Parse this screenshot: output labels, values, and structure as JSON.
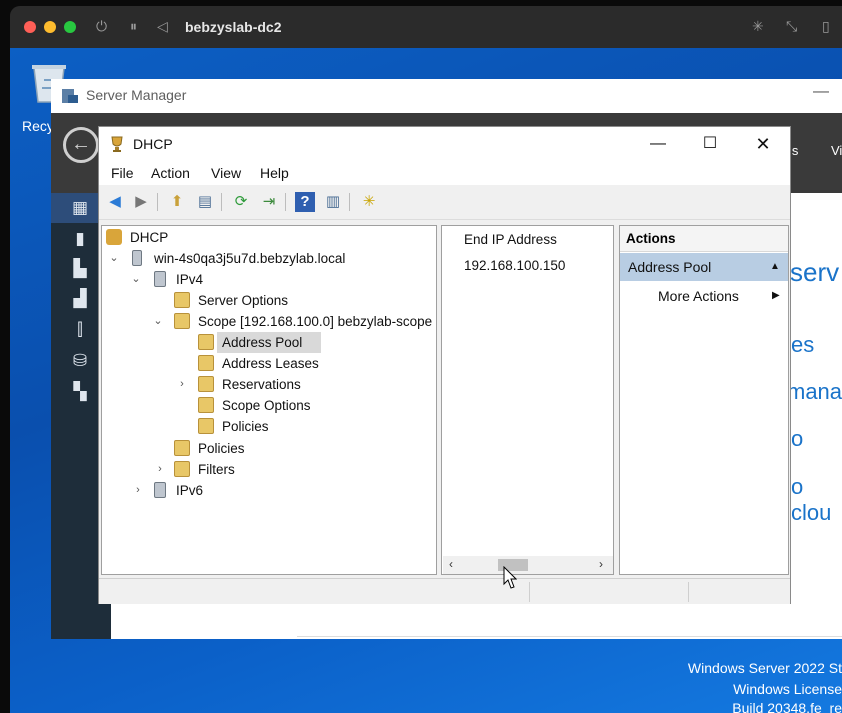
{
  "remote_window": {
    "title": "bebzyslab-dc2"
  },
  "desktop": {
    "recycle_bin_label": "Recy",
    "watermark": {
      "line1": "Windows Server 2022 St",
      "line2": "Windows License",
      "line3": "Build 20348.fe_re"
    }
  },
  "server_manager": {
    "title": "Server Manager",
    "header_partial_1": "ls",
    "header_partial_2": "Vi",
    "content_partial": {
      "serv": "serv",
      "es": "es",
      "mana": "mana",
      "o": "o",
      "clou": "o clou"
    }
  },
  "dhcp": {
    "title": "DHCP",
    "menu": [
      "File",
      "Action",
      "View",
      "Help"
    ],
    "tree": {
      "root": "DHCP",
      "server": "win-4s0qa3j5u7d.bebzylab.local",
      "ipv4": "IPv4",
      "server_options": "Server Options",
      "scope": "Scope [192.168.100.0] bebzylab-scope",
      "address_pool": "Address Pool",
      "address_leases": "Address Leases",
      "reservations": "Reservations",
      "scope_options": "Scope Options",
      "scope_policies": "Policies",
      "policies": "Policies",
      "filters": "Filters",
      "ipv6": "IPv6"
    },
    "list": {
      "column_header": "End IP Address",
      "rows": [
        "192.168.100.150"
      ]
    },
    "actions": {
      "header": "Actions",
      "selected": "Address Pool",
      "more": "More Actions"
    }
  },
  "colors": {
    "desktop_blue": "#0b5bbf",
    "selection_blue": "#b8cde3",
    "traffic_red": "#ff5f57",
    "traffic_yellow": "#febc2e",
    "traffic_green": "#28c840"
  }
}
